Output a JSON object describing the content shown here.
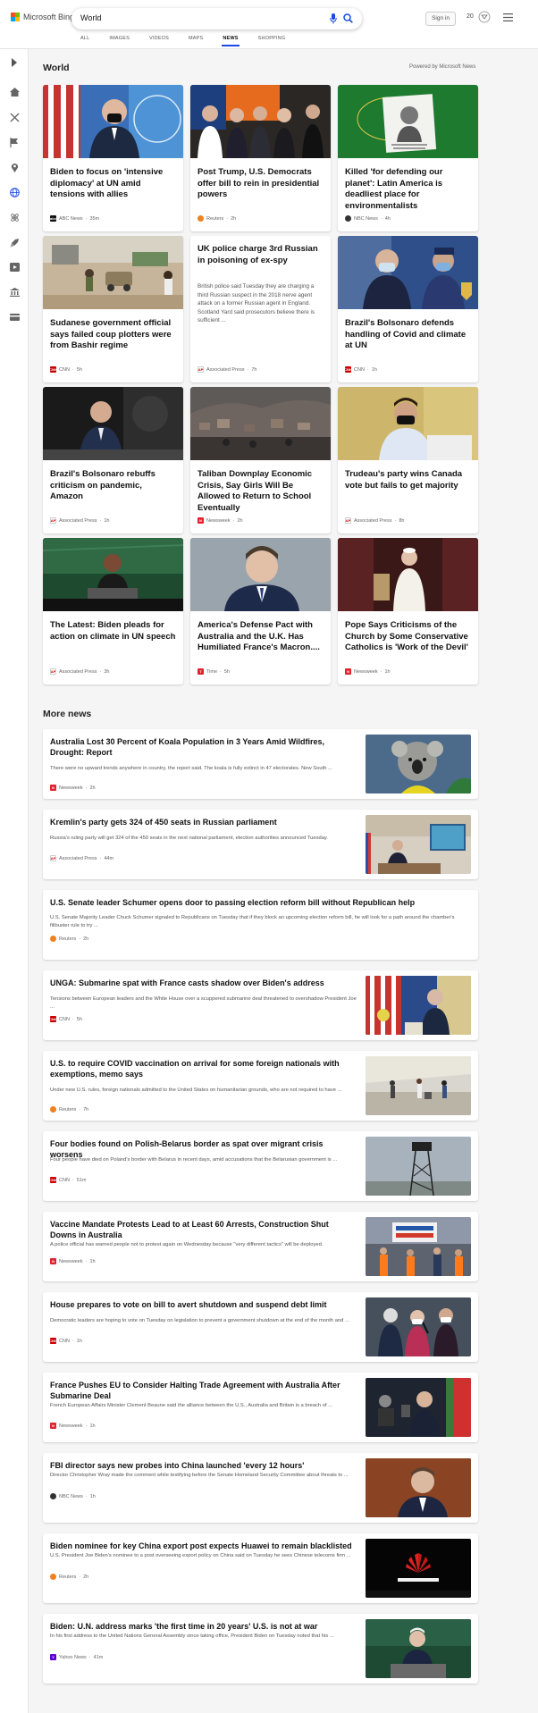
{
  "header": {
    "brand": "Microsoft Bing",
    "search_value": "World",
    "sign_in": "Sign in",
    "points": "20",
    "tabs": [
      "ALL",
      "IMAGES",
      "VIDEOS",
      "MAPS",
      "NEWS",
      "SHOPPING"
    ],
    "active_tab": "NEWS"
  },
  "colors": {
    "accent": "#174ae4",
    "logo": [
      "#f25022",
      "#7fba00",
      "#00a4ef",
      "#ffb900"
    ]
  },
  "rail": {
    "icons": [
      "expand-icon",
      "home-icon",
      "sports-icon",
      "flag-icon",
      "location-icon",
      "globe-icon",
      "science-icon",
      "rocket-icon",
      "entertainment-icon",
      "money-icon",
      "card-icon"
    ]
  },
  "world": {
    "title": "World",
    "powered": "Powered by Microsoft News",
    "cards": [
      {
        "title": "Biden to focus on 'intensive diplomacy' at UN amid tensions with allies",
        "source": "ABC News",
        "time": "35m",
        "src_icon": "abc",
        "snippet": ""
      },
      {
        "title": "Post Trump, U.S. Democrats offer bill to rein in presidential powers",
        "source": "Reuters",
        "time": "2h",
        "src_icon": "reuters",
        "snippet": ""
      },
      {
        "title": "Killed 'for defending our planet': Latin America is deadliest place for environmentalists",
        "source": "NBC News",
        "time": "4h",
        "src_icon": "nbc",
        "snippet": ""
      },
      {
        "title": "Sudanese government official says failed coup plotters were from Bashir regime",
        "source": "CNN",
        "time": "5h",
        "src_icon": "cnn",
        "snippet": ""
      },
      {
        "title": "UK police charge 3rd Russian in poisoning of ex-spy",
        "source": "Associated Press",
        "time": "7h",
        "src_icon": "ap",
        "snippet": "British police said Tuesday they are charging a third Russian suspect in the 2018 nerve agent attack on a former Russian agent in England. Scotland Yard said prosecutors believe there is sufficient ..."
      },
      {
        "title": "Brazil's Bolsonaro defends handling of Covid and climate at UN",
        "source": "CNN",
        "time": "1h",
        "src_icon": "cnn",
        "snippet": ""
      },
      {
        "title": "Brazil's Bolsonaro rebuffs criticism on pandemic, Amazon",
        "source": "Associated Press",
        "time": "1h",
        "src_icon": "ap",
        "snippet": ""
      },
      {
        "title": "Taliban Downplay Economic Crisis, Say Girls Will Be Allowed to Return to School Eventually",
        "source": "Newsweek",
        "time": "2h",
        "src_icon": "newsweek",
        "snippet": ""
      },
      {
        "title": "Trudeau's party wins Canada vote but fails to get majority",
        "source": "Associated Press",
        "time": "8h",
        "src_icon": "ap",
        "snippet": ""
      },
      {
        "title": "The Latest: Biden pleads for action on climate in UN speech",
        "source": "Associated Press",
        "time": "3h",
        "src_icon": "ap",
        "snippet": ""
      },
      {
        "title": "America's Defense Pact with Australia and the U.K. Has Humiliated France's Macron....",
        "source": "Time",
        "time": "5h",
        "src_icon": "time",
        "snippet": ""
      },
      {
        "title": "Pope Says Criticisms of the Church by Some Conservative Catholics is 'Work of the Devil'",
        "source": "Newsweek",
        "time": "1h",
        "src_icon": "newsweek",
        "snippet": ""
      }
    ]
  },
  "more": {
    "title": "More news",
    "items": [
      {
        "title": "Australia Lost 30 Percent of Koala Population in 3 Years Amid Wildfires, Drought: Report",
        "snippet": "There were no upward trends anywhere in country, the report said. The koala is fully extinct in 47 electorates. New South ...",
        "source": "Newsweek",
        "time": "2h",
        "src_icon": "newsweek"
      },
      {
        "title": "Kremlin's party gets 324 of 450 seats in Russian parliament",
        "snippet": "Russia's ruling party will get 324 of the 450 seats in the next national parliament, election authorities announced Tuesday.",
        "source": "Associated Press",
        "time": "44m",
        "src_icon": "ap"
      },
      {
        "title": "U.S. Senate leader Schumer opens door to passing election reform bill without Republican help",
        "snippet": "U.S. Senate Majority Leader Chuck Schumer signaled to Republicans on Tuesday that if they block an upcoming election reform bill, he will look for a path around the chamber's filibuster rule to try ...",
        "source": "Reuters",
        "time": "2h",
        "src_icon": "reuters"
      },
      {
        "title": "UNGA: Submarine spat with France casts shadow over Biden's address",
        "snippet": "Tensions between European leaders and the White House over a scuppered submarine deal threatened to overshadow President Joe ...",
        "source": "CNN",
        "time": "5h",
        "src_icon": "cnn"
      },
      {
        "title": "U.S. to require COVID vaccination on arrival for some foreign nationals with exemptions, memo says",
        "snippet": "Under new U.S. rules, foreign nationals admitted to the United States on humanitarian grounds, who are not required to have ...",
        "source": "Reuters",
        "time": "7h",
        "src_icon": "reuters"
      },
      {
        "title": "Four bodies found on Polish-Belarus border as spat over migrant crisis worsens",
        "snippet": "Four people have died on Poland's border with Belarus in recent days, amid accusations that the Belarusian government is ...",
        "source": "CNN",
        "time": "51m",
        "src_icon": "cnn"
      },
      {
        "title": "Vaccine Mandate Protests Lead to at Least 60 Arrests, Construction Shut Downs in Australia",
        "snippet": "A police official has warned people not to protest again on Wednesday because \"very different tactics\" will be deployed.",
        "source": "Newsweek",
        "time": "1h",
        "src_icon": "newsweek"
      },
      {
        "title": "House prepares to vote on bill to avert shutdown and suspend debt limit",
        "snippet": "Democratic leaders are hoping to vote on Tuesday on legislation to prevent a government shutdown at the end of the month and ...",
        "source": "CNN",
        "time": "1h",
        "src_icon": "cnn"
      },
      {
        "title": "France Pushes EU to Consider Halting Trade Agreement with Australia After Submarine Deal",
        "snippet": "French European Affairs Minister Clement Beaune said the alliance between the U.S., Australia and Britain is a breach of ...",
        "source": "Newsweek",
        "time": "1h",
        "src_icon": "newsweek"
      },
      {
        "title": "FBI director says new probes into China launched 'every 12 hours'",
        "snippet": "Director Christopher Wray made the comment while testifying before the Senate Homeland Security Committee about threats to ...",
        "source": "NBC News",
        "time": "1h",
        "src_icon": "nbc"
      },
      {
        "title": "Biden nominee for key China export post expects Huawei to remain blacklisted",
        "snippet": "U.S. President Joe Biden's nominee to a post overseeing export policy on China said on Tuesday he sees Chinese telecoms firm ...",
        "source": "Reuters",
        "time": "2h",
        "src_icon": "reuters"
      },
      {
        "title": "Biden: U.N. address marks 'the first time in 20 years' U.S. is not at war",
        "snippet": "In his first address to the United Nations General Assembly since taking office, President Biden on Tuesday noted that his ...",
        "source": "Yahoo News",
        "time": "41m",
        "src_icon": "yahoo"
      }
    ]
  }
}
